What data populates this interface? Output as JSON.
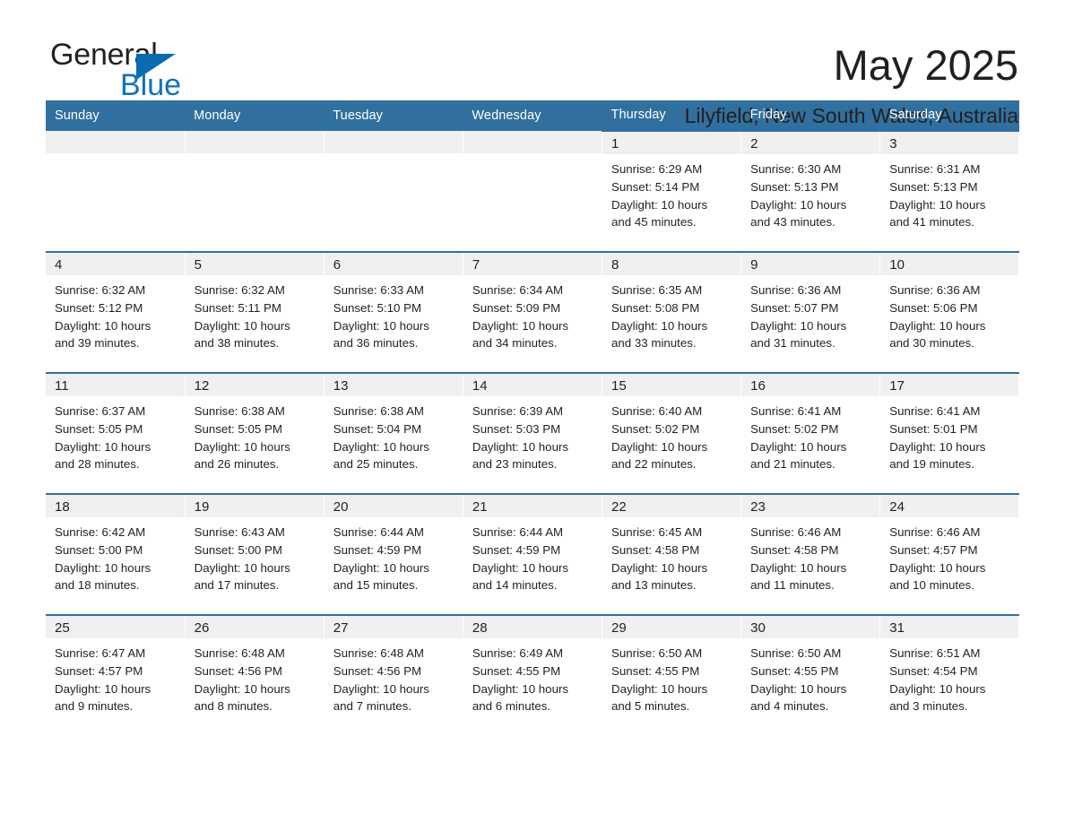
{
  "brand": {
    "word_one": "General",
    "word_two": "Blue",
    "triangle_color": "#0b6ab0",
    "blue_color": "#0f72bb"
  },
  "header": {
    "month_title": "May 2025",
    "location": "Lilyfield, New South Wales, Australia"
  },
  "theme": {
    "header_blue": "#31709e",
    "daynum_grey": "#f0f0f0",
    "text": "#231f20"
  },
  "weekday_headers": [
    "Sunday",
    "Monday",
    "Tuesday",
    "Wednesday",
    "Thursday",
    "Friday",
    "Saturday"
  ],
  "labels": {
    "sunrise_prefix": "Sunrise:",
    "sunset_prefix": "Sunset:",
    "daylight_prefix": "Daylight:"
  },
  "chart_data": {
    "type": "table",
    "title": "May 2025 - Lilyfield, New South Wales, Australia",
    "columns": [
      "Sunday",
      "Monday",
      "Tuesday",
      "Wednesday",
      "Thursday",
      "Friday",
      "Saturday"
    ],
    "first_day_column_index": 4,
    "days_in_month": 31,
    "days": [
      {
        "day": 1,
        "sunrise": "6:29 AM",
        "sunset": "5:14 PM",
        "daylight_hours": 10,
        "daylight_minutes": 45
      },
      {
        "day": 2,
        "sunrise": "6:30 AM",
        "sunset": "5:13 PM",
        "daylight_hours": 10,
        "daylight_minutes": 43
      },
      {
        "day": 3,
        "sunrise": "6:31 AM",
        "sunset": "5:13 PM",
        "daylight_hours": 10,
        "daylight_minutes": 41
      },
      {
        "day": 4,
        "sunrise": "6:32 AM",
        "sunset": "5:12 PM",
        "daylight_hours": 10,
        "daylight_minutes": 39
      },
      {
        "day": 5,
        "sunrise": "6:32 AM",
        "sunset": "5:11 PM",
        "daylight_hours": 10,
        "daylight_minutes": 38
      },
      {
        "day": 6,
        "sunrise": "6:33 AM",
        "sunset": "5:10 PM",
        "daylight_hours": 10,
        "daylight_minutes": 36
      },
      {
        "day": 7,
        "sunrise": "6:34 AM",
        "sunset": "5:09 PM",
        "daylight_hours": 10,
        "daylight_minutes": 34
      },
      {
        "day": 8,
        "sunrise": "6:35 AM",
        "sunset": "5:08 PM",
        "daylight_hours": 10,
        "daylight_minutes": 33
      },
      {
        "day": 9,
        "sunrise": "6:36 AM",
        "sunset": "5:07 PM",
        "daylight_hours": 10,
        "daylight_minutes": 31
      },
      {
        "day": 10,
        "sunrise": "6:36 AM",
        "sunset": "5:06 PM",
        "daylight_hours": 10,
        "daylight_minutes": 30
      },
      {
        "day": 11,
        "sunrise": "6:37 AM",
        "sunset": "5:05 PM",
        "daylight_hours": 10,
        "daylight_minutes": 28
      },
      {
        "day": 12,
        "sunrise": "6:38 AM",
        "sunset": "5:05 PM",
        "daylight_hours": 10,
        "daylight_minutes": 26
      },
      {
        "day": 13,
        "sunrise": "6:38 AM",
        "sunset": "5:04 PM",
        "daylight_hours": 10,
        "daylight_minutes": 25
      },
      {
        "day": 14,
        "sunrise": "6:39 AM",
        "sunset": "5:03 PM",
        "daylight_hours": 10,
        "daylight_minutes": 23
      },
      {
        "day": 15,
        "sunrise": "6:40 AM",
        "sunset": "5:02 PM",
        "daylight_hours": 10,
        "daylight_minutes": 22
      },
      {
        "day": 16,
        "sunrise": "6:41 AM",
        "sunset": "5:02 PM",
        "daylight_hours": 10,
        "daylight_minutes": 21
      },
      {
        "day": 17,
        "sunrise": "6:41 AM",
        "sunset": "5:01 PM",
        "daylight_hours": 10,
        "daylight_minutes": 19
      },
      {
        "day": 18,
        "sunrise": "6:42 AM",
        "sunset": "5:00 PM",
        "daylight_hours": 10,
        "daylight_minutes": 18
      },
      {
        "day": 19,
        "sunrise": "6:43 AM",
        "sunset": "5:00 PM",
        "daylight_hours": 10,
        "daylight_minutes": 17
      },
      {
        "day": 20,
        "sunrise": "6:44 AM",
        "sunset": "4:59 PM",
        "daylight_hours": 10,
        "daylight_minutes": 15
      },
      {
        "day": 21,
        "sunrise": "6:44 AM",
        "sunset": "4:59 PM",
        "daylight_hours": 10,
        "daylight_minutes": 14
      },
      {
        "day": 22,
        "sunrise": "6:45 AM",
        "sunset": "4:58 PM",
        "daylight_hours": 10,
        "daylight_minutes": 13
      },
      {
        "day": 23,
        "sunrise": "6:46 AM",
        "sunset": "4:58 PM",
        "daylight_hours": 10,
        "daylight_minutes": 11
      },
      {
        "day": 24,
        "sunrise": "6:46 AM",
        "sunset": "4:57 PM",
        "daylight_hours": 10,
        "daylight_minutes": 10
      },
      {
        "day": 25,
        "sunrise": "6:47 AM",
        "sunset": "4:57 PM",
        "daylight_hours": 10,
        "daylight_minutes": 9
      },
      {
        "day": 26,
        "sunrise": "6:48 AM",
        "sunset": "4:56 PM",
        "daylight_hours": 10,
        "daylight_minutes": 8
      },
      {
        "day": 27,
        "sunrise": "6:48 AM",
        "sunset": "4:56 PM",
        "daylight_hours": 10,
        "daylight_minutes": 7
      },
      {
        "day": 28,
        "sunrise": "6:49 AM",
        "sunset": "4:55 PM",
        "daylight_hours": 10,
        "daylight_minutes": 6
      },
      {
        "day": 29,
        "sunrise": "6:50 AM",
        "sunset": "4:55 PM",
        "daylight_hours": 10,
        "daylight_minutes": 5
      },
      {
        "day": 30,
        "sunrise": "6:50 AM",
        "sunset": "4:55 PM",
        "daylight_hours": 10,
        "daylight_minutes": 4
      },
      {
        "day": 31,
        "sunrise": "6:51 AM",
        "sunset": "4:54 PM",
        "daylight_hours": 10,
        "daylight_minutes": 3
      }
    ]
  }
}
